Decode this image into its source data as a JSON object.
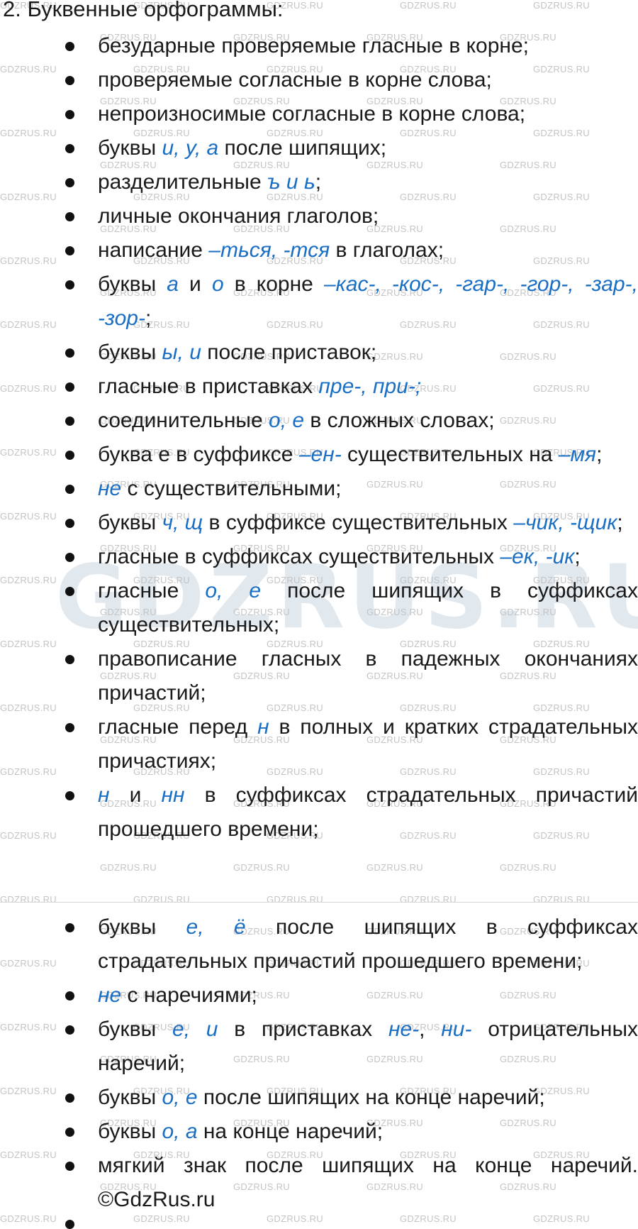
{
  "heading": "2.  Буквенные орфограммы:",
  "items_part1": [
    [
      {
        "t": "безударные проверяемые гласные в корне;"
      }
    ],
    [
      {
        "t": "проверяемые согласные в корне слова;"
      }
    ],
    [
      {
        "t": "непроизносимые согласные в корне слова;"
      }
    ],
    [
      {
        "t": "буквы "
      },
      {
        "t": "и, у, а",
        "hl": true
      },
      {
        "t": " после шипящих;"
      }
    ],
    [
      {
        "t": "разделительные "
      },
      {
        "t": "ъ и ь",
        "hl": true
      },
      {
        "t": ";"
      }
    ],
    [
      {
        "t": "личные окончания глаголов;"
      }
    ],
    [
      {
        "t": "написание "
      },
      {
        "t": "–ться, -тся",
        "hl": true
      },
      {
        "t": " в глаголах;"
      }
    ],
    [
      {
        "t": "буквы "
      },
      {
        "t": "а",
        "hl": true
      },
      {
        "t": " и "
      },
      {
        "t": "о",
        "hl": true
      },
      {
        "t": " в корне "
      },
      {
        "t": "–кас-, -кос-, -гар-, -гор-, -зар-, -зор-",
        "hl": true
      },
      {
        "t": ";"
      }
    ],
    [
      {
        "t": "буквы "
      },
      {
        "t": "ы, и",
        "hl": true
      },
      {
        "t": " после приставок;"
      }
    ],
    [
      {
        "t": "гласные в приставках "
      },
      {
        "t": "пре-, при-;",
        "hl": true
      }
    ],
    [
      {
        "t": "соединительные "
      },
      {
        "t": "о, е",
        "hl": true
      },
      {
        "t": " в сложных словах;"
      }
    ],
    [
      {
        "t": "буква е в суффиксе "
      },
      {
        "t": "–ен-",
        "hl": true
      },
      {
        "t": " существительных на "
      },
      {
        "t": "–мя",
        "hl": true
      },
      {
        "t": ";"
      }
    ],
    [
      {
        "t": "не",
        "hl": true
      },
      {
        "t": " с существительными;"
      }
    ],
    [
      {
        "t": "буквы "
      },
      {
        "t": "ч, щ",
        "hl": true
      },
      {
        "t": " в суффиксе существительных "
      },
      {
        "t": "–чик, -щик",
        "hl": true
      },
      {
        "t": ";"
      }
    ],
    [
      {
        "t": "гласные в суффиксах существительных "
      },
      {
        "t": "–ек, -ик",
        "hl": true
      },
      {
        "t": ";"
      }
    ],
    [
      {
        "t": "гласные "
      },
      {
        "t": "о, е",
        "hl": true
      },
      {
        "t": " после шипящих в суффиксах существительных;"
      }
    ],
    [
      {
        "t": "правописание гласных в падежных окончаниях причастий;"
      }
    ],
    [
      {
        "t": "гласные перед "
      },
      {
        "t": "н",
        "hl": true
      },
      {
        "t": " в полных и кратких страдательных причастиях;"
      }
    ],
    [
      {
        "t": "н",
        "hl": true
      },
      {
        "t": " и "
      },
      {
        "t": "нн",
        "hl": true
      },
      {
        "t": " в суффиксах страдательных причастий прошедшего времени;"
      }
    ]
  ],
  "items_part2": [
    [
      {
        "t": "буквы "
      },
      {
        "t": "е, ё",
        "hl": true
      },
      {
        "t": " после шипящих в суффиксах страдательных причастий прошедшего времени;"
      }
    ],
    [
      {
        "t": "не",
        "hl": true
      },
      {
        "t": " с наречиями;"
      }
    ],
    [
      {
        "t": "буквы "
      },
      {
        "t": "е, и",
        "hl": true
      },
      {
        "t": " в приставках "
      },
      {
        "t": "не-",
        "hl": true
      },
      {
        "t": ", "
      },
      {
        "t": "ни-",
        "hl": true
      },
      {
        "t": " отрицательных наречий;"
      }
    ],
    [
      {
        "t": "буквы "
      },
      {
        "t": "о, е",
        "hl": true
      },
      {
        "t": " после шипящих на конце наречий;"
      }
    ],
    [
      {
        "t": "буквы "
      },
      {
        "t": "о, а",
        "hl": true
      },
      {
        "t": " на конце наречий;"
      }
    ],
    [
      {
        "t": "мягкий знак после шипящих на конце наречий. ©GdzRus.ru"
      }
    ]
  ],
  "watermark": {
    "small": "GDZRUS.RU",
    "big": "GDZRUS.RU"
  },
  "colors": {
    "highlight": "#1a6fc4",
    "text": "#1a1a1a",
    "watermark": "#c4c4c4"
  }
}
